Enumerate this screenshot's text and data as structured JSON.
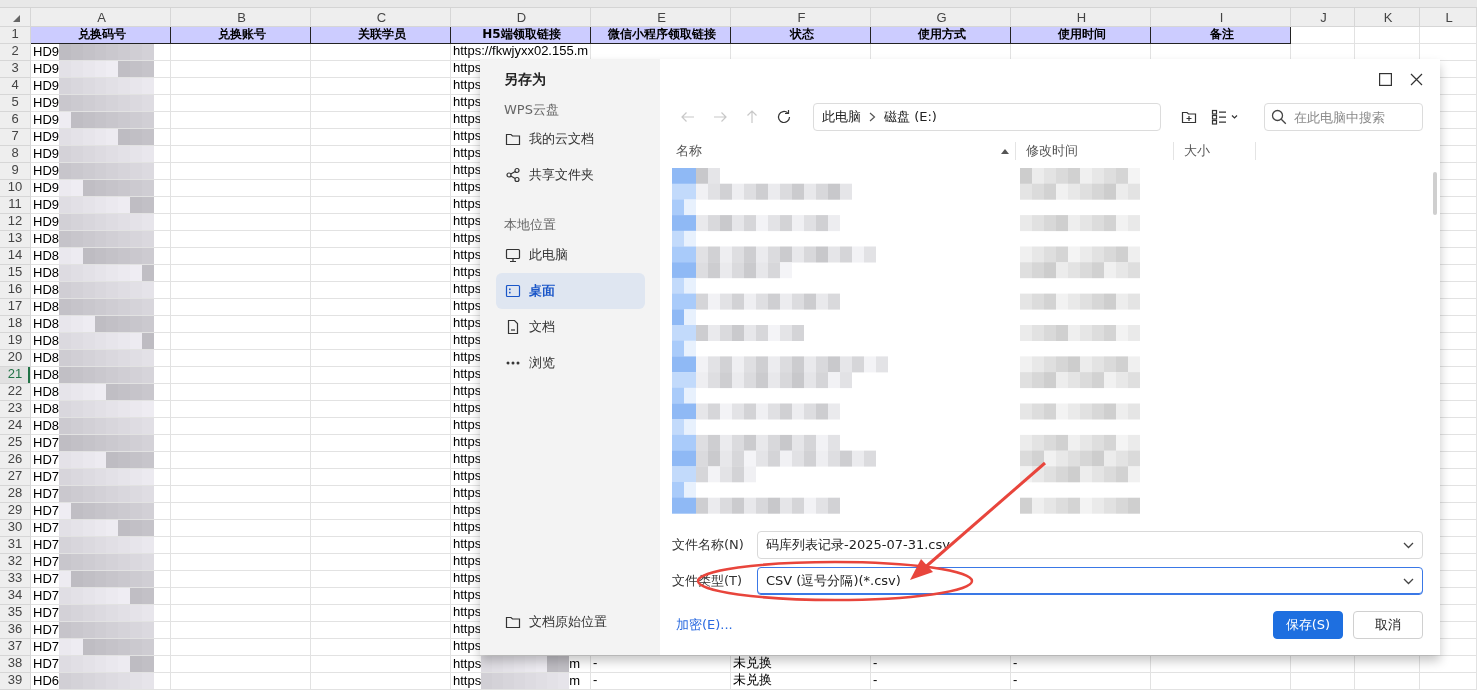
{
  "sheet": {
    "column_letters": [
      "A",
      "B",
      "C",
      "D",
      "E",
      "F",
      "G",
      "H",
      "I",
      "J",
      "K",
      "L"
    ],
    "header": {
      "number": "1",
      "cells": [
        "兑换码号",
        "兑换账号",
        "关联学员",
        "H5端领取链接",
        "微信小程序领取链接",
        "状态",
        "使用方式",
        "使用时间",
        "备注"
      ]
    },
    "rows": [
      {
        "number": "2",
        "selected": false,
        "cells": {
          "A": {
            "text": "HD9",
            "redacted": true
          },
          "D": {
            "text": "https://fkwjyxx02.155.m",
            "redacted": false
          }
        }
      },
      {
        "number": "3",
        "selected": false,
        "cells": {
          "A": {
            "text": "HD9",
            "redacted": true
          },
          "D": {
            "text": "https",
            "redacted": false
          }
        }
      },
      {
        "number": "4",
        "selected": false,
        "cells": {
          "A": {
            "text": "HD9",
            "redacted": true
          },
          "D": {
            "text": "https",
            "redacted": false
          }
        }
      },
      {
        "number": "5",
        "selected": false,
        "cells": {
          "A": {
            "text": "HD9",
            "redacted": true
          },
          "D": {
            "text": "https",
            "redacted": false
          }
        }
      },
      {
        "number": "6",
        "selected": false,
        "cells": {
          "A": {
            "text": "HD9",
            "redacted": true
          },
          "D": {
            "text": "https",
            "redacted": false
          }
        }
      },
      {
        "number": "7",
        "selected": false,
        "cells": {
          "A": {
            "text": "HD9",
            "redacted": true
          },
          "D": {
            "text": "https",
            "redacted": false
          }
        }
      },
      {
        "number": "8",
        "selected": false,
        "cells": {
          "A": {
            "text": "HD9",
            "redacted": true
          },
          "D": {
            "text": "https",
            "redacted": false
          }
        }
      },
      {
        "number": "9",
        "selected": false,
        "cells": {
          "A": {
            "text": "HD9",
            "redacted": true
          },
          "D": {
            "text": "https",
            "redacted": false
          }
        }
      },
      {
        "number": "10",
        "selected": false,
        "cells": {
          "A": {
            "text": "HD9",
            "redacted": true
          },
          "D": {
            "text": "https",
            "redacted": false
          }
        }
      },
      {
        "number": "11",
        "selected": false,
        "cells": {
          "A": {
            "text": "HD9",
            "redacted": true
          },
          "D": {
            "text": "https",
            "redacted": false
          }
        }
      },
      {
        "number": "12",
        "selected": false,
        "cells": {
          "A": {
            "text": "HD9",
            "redacted": true
          },
          "D": {
            "text": "https",
            "redacted": false
          }
        }
      },
      {
        "number": "13",
        "selected": false,
        "cells": {
          "A": {
            "text": "HD8",
            "redacted": true
          },
          "D": {
            "text": "https",
            "redacted": false
          }
        }
      },
      {
        "number": "14",
        "selected": false,
        "cells": {
          "A": {
            "text": "HD8",
            "redacted": true
          },
          "D": {
            "text": "https",
            "redacted": false
          }
        }
      },
      {
        "number": "15",
        "selected": false,
        "cells": {
          "A": {
            "text": "HD8",
            "redacted": true
          },
          "D": {
            "text": "https",
            "redacted": false
          }
        }
      },
      {
        "number": "16",
        "selected": false,
        "cells": {
          "A": {
            "text": "HD8",
            "redacted": true
          },
          "D": {
            "text": "https",
            "redacted": false
          }
        }
      },
      {
        "number": "17",
        "selected": false,
        "cells": {
          "A": {
            "text": "HD8",
            "redacted": true
          },
          "D": {
            "text": "https",
            "redacted": false
          }
        }
      },
      {
        "number": "18",
        "selected": false,
        "cells": {
          "A": {
            "text": "HD8",
            "redacted": true
          },
          "D": {
            "text": "https",
            "redacted": false
          }
        }
      },
      {
        "number": "19",
        "selected": false,
        "cells": {
          "A": {
            "text": "HD8",
            "redacted": true
          },
          "D": {
            "text": "https",
            "redacted": false
          }
        }
      },
      {
        "number": "20",
        "selected": false,
        "cells": {
          "A": {
            "text": "HD8",
            "redacted": true
          },
          "D": {
            "text": "https",
            "redacted": false
          }
        }
      },
      {
        "number": "21",
        "selected": true,
        "cells": {
          "A": {
            "text": "HD8",
            "redacted": true
          },
          "D": {
            "text": "https",
            "redacted": false
          }
        }
      },
      {
        "number": "22",
        "selected": false,
        "cells": {
          "A": {
            "text": "HD8",
            "redacted": true
          },
          "D": {
            "text": "https",
            "redacted": false
          }
        }
      },
      {
        "number": "23",
        "selected": false,
        "cells": {
          "A": {
            "text": "HD8",
            "redacted": true
          },
          "D": {
            "text": "https",
            "redacted": false
          }
        }
      },
      {
        "number": "24",
        "selected": false,
        "cells": {
          "A": {
            "text": "HD8",
            "redacted": true
          },
          "D": {
            "text": "https",
            "redacted": false
          }
        }
      },
      {
        "number": "25",
        "selected": false,
        "cells": {
          "A": {
            "text": "HD7",
            "redacted": true
          },
          "D": {
            "text": "https",
            "redacted": false
          }
        }
      },
      {
        "number": "26",
        "selected": false,
        "cells": {
          "A": {
            "text": "HD7",
            "redacted": true
          },
          "D": {
            "text": "https",
            "redacted": false
          }
        }
      },
      {
        "number": "27",
        "selected": false,
        "cells": {
          "A": {
            "text": "HD7",
            "redacted": true
          },
          "D": {
            "text": "https",
            "redacted": false
          }
        }
      },
      {
        "number": "28",
        "selected": false,
        "cells": {
          "A": {
            "text": "HD7",
            "redacted": true
          },
          "D": {
            "text": "https",
            "redacted": false
          }
        }
      },
      {
        "number": "29",
        "selected": false,
        "cells": {
          "A": {
            "text": "HD7",
            "redacted": true
          },
          "D": {
            "text": "https",
            "redacted": false
          }
        }
      },
      {
        "number": "30",
        "selected": false,
        "cells": {
          "A": {
            "text": "HD7",
            "redacted": true
          },
          "D": {
            "text": "https",
            "redacted": false
          }
        }
      },
      {
        "number": "31",
        "selected": false,
        "cells": {
          "A": {
            "text": "HD7",
            "redacted": true
          },
          "D": {
            "text": "https",
            "redacted": false
          }
        }
      },
      {
        "number": "32",
        "selected": false,
        "cells": {
          "A": {
            "text": "HD7",
            "redacted": true
          },
          "D": {
            "text": "https",
            "redacted": false
          }
        }
      },
      {
        "number": "33",
        "selected": false,
        "cells": {
          "A": {
            "text": "HD7",
            "redacted": true
          },
          "D": {
            "text": "https",
            "redacted": false
          }
        }
      },
      {
        "number": "34",
        "selected": false,
        "cells": {
          "A": {
            "text": "HD7",
            "redacted": true
          },
          "D": {
            "text": "https",
            "redacted": false
          }
        }
      },
      {
        "number": "35",
        "selected": false,
        "cells": {
          "A": {
            "text": "HD7",
            "redacted": true
          },
          "D": {
            "text": "https",
            "redacted": false
          }
        }
      },
      {
        "number": "36",
        "selected": false,
        "cells": {
          "A": {
            "text": "HD7",
            "redacted": true
          },
          "D": {
            "text": "https",
            "redacted": false
          }
        }
      },
      {
        "number": "37",
        "selected": false,
        "cells": {
          "A": {
            "text": "HD7",
            "redacted": true
          },
          "D": {
            "text": "https",
            "redacted": false
          }
        }
      },
      {
        "number": "38",
        "selected": false,
        "cells": {
          "A": {
            "text": "HD7",
            "redacted": true
          },
          "D": {
            "text": "https",
            "redacted": true,
            "tail": "m"
          },
          "E": {
            "text": "-",
            "redacted": false
          },
          "F": {
            "text": "未兑换",
            "redacted": false
          },
          "G": {
            "text": "-",
            "redacted": false
          },
          "H": {
            "text": "-",
            "redacted": false
          }
        }
      },
      {
        "number": "39",
        "selected": false,
        "cells": {
          "A": {
            "text": "HD6",
            "redacted": true
          },
          "D": {
            "text": "https",
            "redacted": true,
            "tail": "m"
          },
          "E": {
            "text": "-",
            "redacted": false
          },
          "F": {
            "text": "未兑换",
            "redacted": false
          },
          "G": {
            "text": "-",
            "redacted": false
          },
          "H": {
            "text": "-",
            "redacted": false
          }
        }
      }
    ]
  },
  "dialog": {
    "title": "另存为",
    "sidebar": {
      "sections": [
        {
          "heading": "WPS云盘",
          "items": [
            {
              "label": "我的云文档",
              "kind": "folder",
              "selected": false
            },
            {
              "label": "共享文件夹",
              "kind": "share",
              "selected": false
            }
          ]
        },
        {
          "heading": "本地位置",
          "items": [
            {
              "label": "此电脑",
              "kind": "computer",
              "selected": false
            },
            {
              "label": "桌面",
              "kind": "desktop",
              "selected": true
            },
            {
              "label": "文档",
              "kind": "document",
              "selected": false
            },
            {
              "label": "浏览",
              "kind": "more",
              "selected": false
            }
          ]
        }
      ],
      "footer_item": {
        "label": "文档原始位置",
        "kind": "folder"
      }
    },
    "nav_buttons": [
      {
        "kind": "back",
        "disabled": true
      },
      {
        "kind": "forward",
        "disabled": true
      },
      {
        "kind": "up",
        "disabled": true
      },
      {
        "kind": "refresh",
        "disabled": false
      }
    ],
    "breadcrumb": [
      "此电脑",
      "磁盘 (E:)"
    ],
    "search": {
      "placeholder": "在此电脑中搜索"
    },
    "columns": [
      {
        "label": "名称",
        "sorted": true
      },
      {
        "label": "修改时间",
        "sorted": false
      },
      {
        "label": "大小",
        "sorted": false
      }
    ],
    "filename": {
      "label": "文件名称(N)",
      "value": "码库列表记录-2025-07-31.csv",
      "focused": false
    },
    "filetype": {
      "label": "文件类型(T)",
      "value": "CSV (逗号分隔)(*.csv)",
      "focused": true
    },
    "link": "加密(E)...",
    "buttons": [
      {
        "label": "保存(S)",
        "primary": true
      },
      {
        "label": "取消",
        "primary": false
      }
    ]
  }
}
